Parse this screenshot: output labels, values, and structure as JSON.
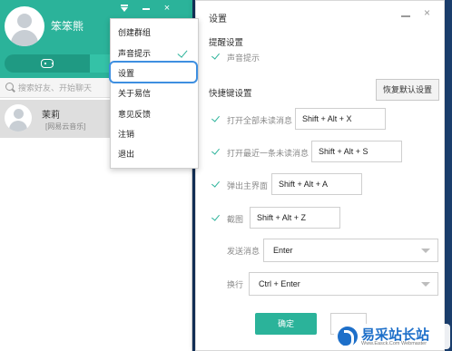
{
  "left_panel": {
    "username": "笨笨熊",
    "search": {
      "placeholder": "搜索好友、开始聊天"
    },
    "contacts": [
      {
        "name": "茉莉",
        "status": "[网易云音乐]"
      }
    ]
  },
  "menu": {
    "items": [
      "创建群组",
      "声音提示",
      "设置",
      "关于易信",
      "意见反馈",
      "注销",
      "退出"
    ],
    "checked_item": "声音提示",
    "highlighted_item": "设置"
  },
  "settings": {
    "title": "设置",
    "close_glyph": "×",
    "reminder": {
      "heading": "提醒设置",
      "sound_label": "声音提示",
      "sound_checked": true
    },
    "shortcuts": {
      "heading": "快捷键设置",
      "restore_label": "恢复默认设置",
      "items": [
        {
          "label": "打开全部未读消息",
          "hotkey": "Shift + Alt + X",
          "checked": true
        },
        {
          "label": "打开最近一条未读消息",
          "hotkey": "Shift + Alt + S",
          "checked": true
        },
        {
          "label": "弹出主界面",
          "hotkey": "Shift + Alt + A",
          "checked": true
        },
        {
          "label": "截图",
          "hotkey": "Shift + Alt + Z",
          "checked": true
        }
      ],
      "send_label": "发送消息",
      "send_value": "Enter",
      "newline_label": "换行",
      "newline_value": "Ctrl + Enter"
    },
    "ok_label": "确定"
  },
  "window_controls": {
    "close_glyph": "×"
  },
  "watermark": {
    "text": "易采站长站",
    "url": "Www.Easck.Com  Webmaster"
  },
  "colors": {
    "accent": "#2bb39a",
    "highlight": "#3e8fe0",
    "brand": "#1d6fc9"
  }
}
